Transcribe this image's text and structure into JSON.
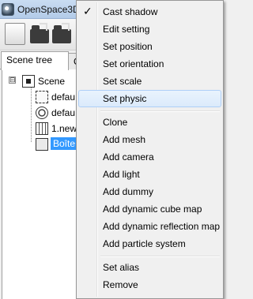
{
  "app": {
    "title": "OpenSpace3D",
    "logo_icon": "openspace3d-logo-icon"
  },
  "toolbar": {
    "buttons": [
      {
        "name": "new-scene-button",
        "icon": "new-file-icon"
      },
      {
        "name": "open-button",
        "icon": "open-folder-icon"
      },
      {
        "name": "save-button",
        "icon": "save-folder-icon"
      }
    ]
  },
  "tabs": [
    {
      "label": "Scene tree",
      "active": true
    },
    {
      "label": "O",
      "active": false
    }
  ],
  "tree": {
    "nodes": [
      {
        "label": "Scene",
        "icon": "scene-icon",
        "expander": "⊟"
      },
      {
        "label": "defau",
        "icon": "camera-icon"
      },
      {
        "label": "defau",
        "icon": "light-icon"
      },
      {
        "label": "1.new",
        "icon": "mesh-icon"
      },
      {
        "label": "Boîte",
        "icon": "box-icon",
        "selected": true
      }
    ]
  },
  "context_menu": {
    "check_mark": "✓",
    "items": [
      {
        "label": "Cast shadow",
        "checked": true
      },
      {
        "label": "Edit setting"
      },
      {
        "label": "Set position"
      },
      {
        "label": "Set orientation"
      },
      {
        "label": "Set scale"
      },
      {
        "label": "Set physic",
        "hover": true
      },
      {
        "label": "Clone"
      },
      {
        "label": "Add mesh"
      },
      {
        "label": "Add camera"
      },
      {
        "label": "Add light"
      },
      {
        "label": "Add dummy"
      },
      {
        "label": "Add dynamic cube map"
      },
      {
        "label": "Add dynamic reflection map"
      },
      {
        "label": "Add particle system"
      },
      {
        "label": "Set alias"
      },
      {
        "label": "Remove"
      }
    ]
  },
  "colors": {
    "selection": "#3399ff",
    "menu_hover": "#dbeafb",
    "menu_background": "#f0f0f0"
  }
}
